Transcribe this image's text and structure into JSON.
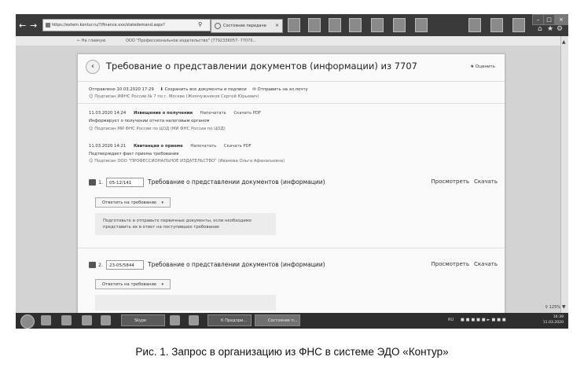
{
  "browser": {
    "url": "https://extern.kontur.ru/?/finance.xxx/statedemand.aspx?",
    "tab_title": "Состояние передачи",
    "tab_close": "×",
    "home_link": "← На главную",
    "org_breadcrumb": "ООО \"Профессиональное издательство\" (7792336057- 77070..."
  },
  "card": {
    "title": "Требование о представлении документов (информации) из 7707",
    "rate_label": "★ Оценить",
    "sent_line": "Отправлено 10.03.2020 17:29",
    "save_all": "Сохранить все документы и подписи",
    "send_email": "Отправить на эл.почту",
    "sent_signed": "Подписан ИФНС России № 7 по г. Москве (Жемчужников Сергей Юрьевич)",
    "events": [
      {
        "datetime": "11.03.2020 14:24",
        "name": "Извещение о получении",
        "print": "Напечатать",
        "download_pdf": "Скачать PDF",
        "desc": "Информирует о получении отчета налоговым органом",
        "signed": "Подписан МИ ФНС России по ЦОД (МИ ФНС России по ЦОД)"
      },
      {
        "datetime": "11.03.2020 14:21",
        "name": "Квитанция о приеме",
        "print": "Напечатать",
        "download_pdf": "Скачать PDF",
        "desc": "Подтверждает факт приема требования",
        "signed": "Подписан ООО \"ПРОФЕССИОНАЛЬНОЕ ИЗДАТЕЛЬСТВО\" (Иванова Ольга Афанасьевна)"
      }
    ],
    "documents": [
      {
        "index": "1.",
        "number": "05-12/141",
        "title": "Требование о представлении документов (информации)",
        "view": "Просмотреть",
        "download": "Скачать",
        "reply_button": "Ответить на требование",
        "info": "Подготовьте и отправьте первичные документы, если необходимо представить их в ответ на поступившее требование"
      },
      {
        "index": "2.",
        "number": "23-05/5844",
        "title": "Требование о представлении документов (информации)",
        "view": "Просмотреть",
        "download": "Скачать",
        "reply_button": "Ответить на требование"
      }
    ]
  },
  "status": {
    "zoom": "125%"
  },
  "taskbar": {
    "items": [
      "Skype",
      "К Предпри...",
      "Состояние п..."
    ],
    "tray_lang": "RU",
    "time": "16:39",
    "date": "11.03.2020"
  },
  "caption": "Рис. 1. Запрос в организацию из ФНС в системе ЭДО «Контур»"
}
